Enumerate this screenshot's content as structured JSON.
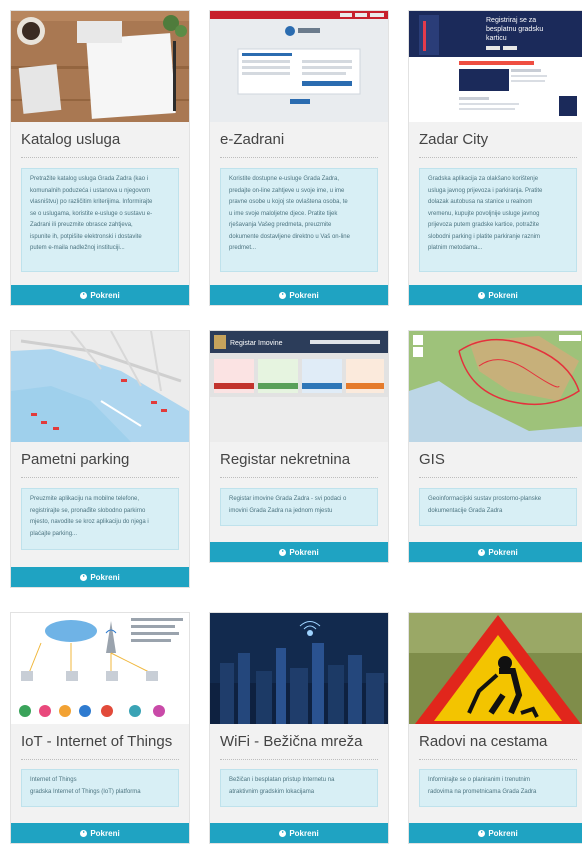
{
  "button_label": "Pokreni",
  "cards": [
    {
      "title": "Katalog usluga",
      "description": [
        "Pretražite katalog usluga Grada Zadra (kao i",
        "komunalnih poduzeća i ustanova u njegovom",
        "vlasništvu) po različitim kriterijima. Informirajte",
        "se o uslugama, koristite e-usluge o sustavu e-",
        "Zadrani ili preuzmite obrasce zahtjeva,",
        "ispunite ih, potpišite elektronski i dostavite",
        "putem e-maila nadležnoj instituciji..."
      ]
    },
    {
      "title": "e-Zadrani",
      "description": [
        "Koristite dostupne e-usluge Grada Zadra,",
        "predajte on-line zahtjeve u svoje ime, u ime",
        "pravne osobe u kojoj ste ovlaštena osoba, te",
        "u ime svoje maloljetne djece. Pratite tijek",
        "rješavanja Vašeg predmeta, preuzmite",
        "dokumente dostavljene direktno u Vaš on-line",
        "predmet..."
      ]
    },
    {
      "title": "Zadar City",
      "description": [
        "Gradska aplikacija za olakšano korištenje",
        "usluga javnog prijevoza i parkiranja. Pratite",
        "dolazak autobusa na stanice u realnom",
        "vremenu, kupujte povoljnije usluge javnog",
        "prijevoza putem gradske kartice, potražite",
        "slobodni parking i platite parkiranje raznim",
        "platnim metodama..."
      ]
    },
    {
      "title": "Pametni parking",
      "description": [
        "Preuzmite aplikaciju na mobilne telefone,",
        "registrirajte se, pronađite slobodno parkirno",
        "mjesto, navodite se kroz aplikaciju do njega i",
        "plaćajte parking..."
      ]
    },
    {
      "title": "Registar nekretnina",
      "description": [
        "Registar imovine Grada Zadra - svi podaci o",
        "imovini Grada Zadra na jednom mjestu"
      ]
    },
    {
      "title": "GIS",
      "description": [
        "Geoinformacijski sustav prostorno-planske",
        "dokumentacije Grada Zadra"
      ]
    },
    {
      "title": "IoT - Internet of Things",
      "description": [
        "Internet of Things",
        "gradska Internet of Things (IoT) platforma"
      ]
    },
    {
      "title": "WiFi - Bežična mreža",
      "description": [
        "Bežičan i besplatan pristup Internetu na",
        "atraktivnim gradskim lokacijama"
      ]
    },
    {
      "title": "Radovi na cestama",
      "description": [
        "Informirajte se o planiranim i trenutnim",
        "radovima na prometnicama Grada Zadra"
      ]
    }
  ],
  "zadar_city_thumb": {
    "headline": [
      "Registriraj se za",
      "besplatnu gradsku",
      "karticu"
    ]
  },
  "registar_thumb": {
    "header": "Registar Imovine"
  }
}
